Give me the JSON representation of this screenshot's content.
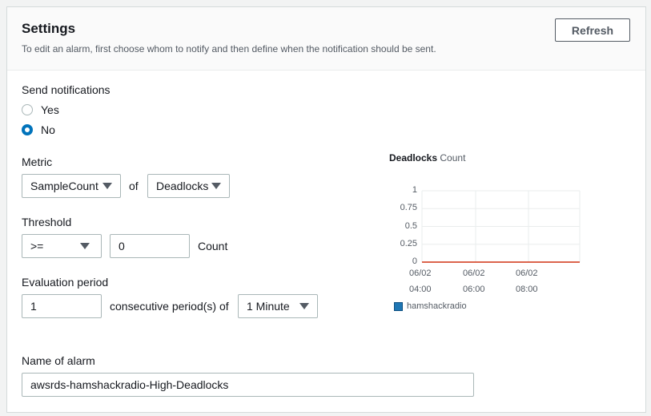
{
  "header": {
    "title": "Settings",
    "description": "To edit an alarm, first choose whom to notify and then define when the notification should be sent.",
    "refresh_label": "Refresh"
  },
  "notifications": {
    "label": "Send notifications",
    "options": [
      {
        "label": "Yes",
        "selected": false
      },
      {
        "label": "No",
        "selected": true
      }
    ]
  },
  "metric": {
    "label": "Metric",
    "statistic": "SampleCount",
    "of_label": "of",
    "name": "Deadlocks"
  },
  "threshold": {
    "label": "Threshold",
    "operator": ">=",
    "value": "0",
    "unit": "Count"
  },
  "evaluation": {
    "label": "Evaluation period",
    "periods": "1",
    "consecutive_label": "consecutive period(s) of",
    "duration": "1 Minute"
  },
  "alarm_name": {
    "label": "Name of alarm",
    "value": "awsrds-hamshackradio-High-Deadlocks"
  },
  "chart_data": {
    "type": "line",
    "title": "Deadlocks",
    "subtitle": "Count",
    "y_ticks": [
      "1",
      "0.75",
      "0.5",
      "0.25",
      "0"
    ],
    "ylim": [
      0,
      1
    ],
    "x_ticks": [
      {
        "date": "06/02",
        "time": "04:00"
      },
      {
        "date": "06/02",
        "time": "06:00"
      },
      {
        "date": "06/02",
        "time": "08:00"
      }
    ],
    "series": [
      {
        "name": "hamshackradio",
        "values": [
          0,
          0,
          0,
          0
        ],
        "color": "#d13212"
      }
    ],
    "legend_color": "#1f77b4",
    "grid": true
  }
}
